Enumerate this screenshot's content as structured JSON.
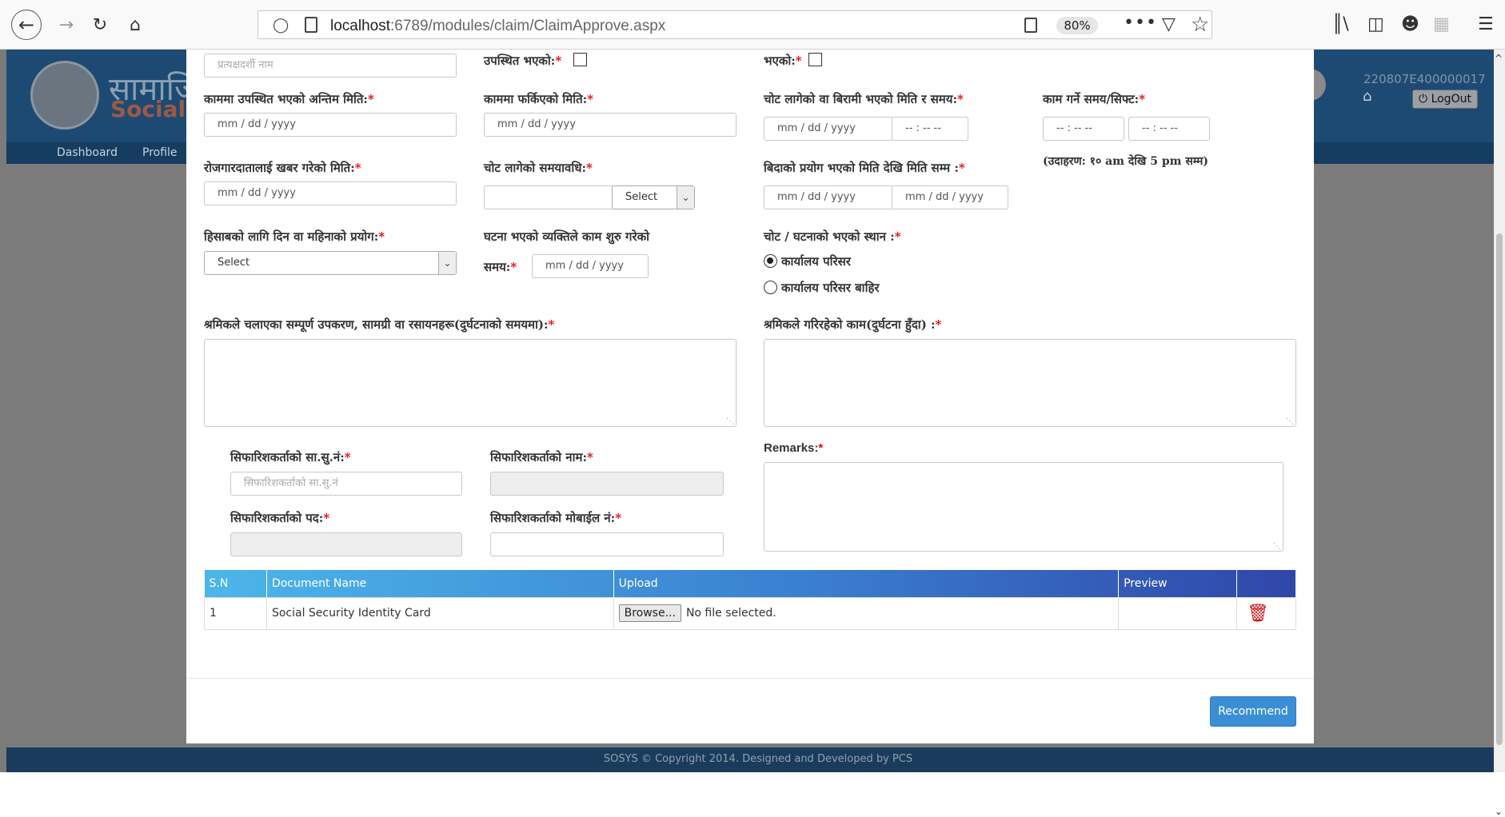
{
  "browser": {
    "url_host": "localhost",
    "url_path": ":6789/modules/claim/ClaimApprove.aspx",
    "zoom": "80%",
    "dots": "•••"
  },
  "site": {
    "brand_np": "सामाजि",
    "brand_en": "Social",
    "nav": [
      "Dashboard",
      "Profile"
    ],
    "user_id": "220807E400000017",
    "logout": "LogOut",
    "footer": "SOSYS © Copyright 2014. Designed and Developed by PCS"
  },
  "form": {
    "witness_name_ph": "प्रत्यक्षदर्शी नाम",
    "present_label": "उपस्थित भएको:",
    "happened_label": "भएको:",
    "last_present_date_label": "काममा उपस्थित भएको अन्तिम मिति:",
    "return_date_label": "काममा फर्किएको मिति:",
    "injury_date_time_label": "चोट लागेको वा बिरामी भएको मिति र समय:",
    "work_shift_label": "काम गर्ने समय/सिफ्ट:",
    "employer_informed_label": "रोजगारदातालाई खबर गरेको मिति:",
    "injury_period_label": "चोट लागेको समयावधि:",
    "leave_period_label": "बिदाको प्रयोग भएको मिति देखि मिति सम्म :",
    "shift_example": "(उदाहरण: १० am देखि 5 pm सम्म)",
    "calc_label": "हिसाबको लागि दिन वा महिनाको प्रयोग:",
    "work_start_label_1": "घटना भएको व्यक्तिले काम शुरु गरेको",
    "work_start_label_2": "समय:",
    "location_label": "चोट / घटनाको भएको स्थान :",
    "location_opt_1": "कार्यालय परिसर",
    "location_opt_2": "कार्यालय परिसर बाहिर",
    "equipment_label": "श्रमिकले चलाएका सम्पूर्ण उपकरण, सामग्री वा रसायनहरू(दुर्घटनाको समयमा):",
    "worker_task_label": "श्रमिकले गरिरहेको काम(दुर्घटना हुँदा) :",
    "recommender_ssn_label": "सिफारिशकर्ताको सा.सु.नं:",
    "recommender_ssn_ph": "सिफारिशकर्ताको सा.सु.नं",
    "recommender_name_label": "सिफारिशकर्ताको नाम:",
    "recommender_post_label": "सिफारिशकर्ताको पद:",
    "recommender_mobile_label": "सिफारिशकर्ताको मोबाईल नं:",
    "remarks_label": "Remarks:",
    "req": "*",
    "date_ph": "mm / dd / yyyy",
    "time_ph": "-- : --  --",
    "select": "Select"
  },
  "table": {
    "headers": [
      "S.N",
      "Document Name",
      "Upload",
      "Preview",
      ""
    ],
    "rows": [
      {
        "sn": "1",
        "doc": "Social Security Identity Card",
        "browse": "Browse...",
        "file": "No file selected."
      }
    ]
  },
  "actions": {
    "recommend": "Recommend"
  },
  "colors": {
    "table_header_start": "#4cb6ea",
    "table_header_end": "#3046a8",
    "button": "#3a8fd4",
    "required": "#ee0000"
  }
}
